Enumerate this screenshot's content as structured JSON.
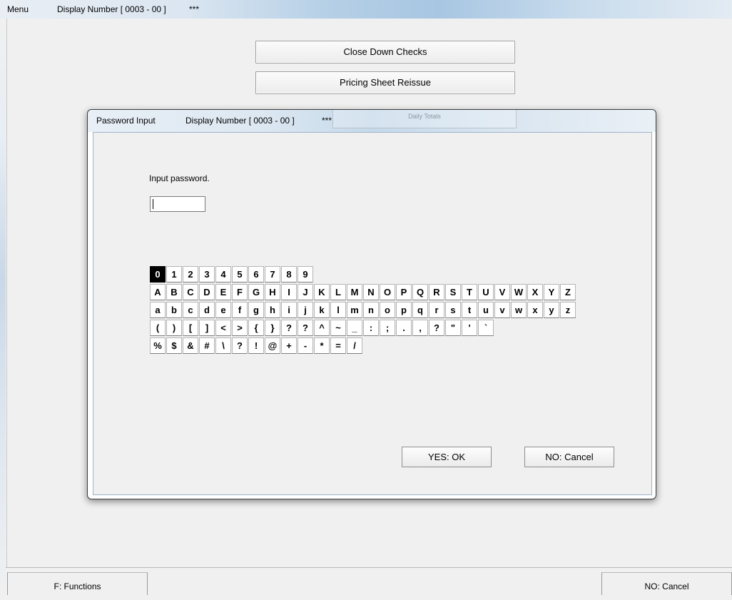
{
  "window": {
    "menu_label": "Menu",
    "display_number": "Display Number [ 0003 - 00 ]",
    "stars": "***"
  },
  "menu_buttons": [
    {
      "label": "Close Down Checks"
    },
    {
      "label": "Pricing Sheet Reissue"
    },
    {
      "label": "Daily Totals"
    }
  ],
  "dialog": {
    "title": "Password Input",
    "display_number": "Display Number [ 0003 - 00 ]",
    "stars": "***",
    "prompt": "Input password.",
    "password_value": "",
    "ok_label": "YES: OK",
    "cancel_label": "NO: Cancel"
  },
  "keyboard": {
    "selected": "0",
    "rows": [
      [
        "0",
        "1",
        "2",
        "3",
        "4",
        "5",
        "6",
        "7",
        "8",
        "9"
      ],
      [
        "A",
        "B",
        "C",
        "D",
        "E",
        "F",
        "G",
        "H",
        "I",
        "J",
        "K",
        "L",
        "M",
        "N",
        "O",
        "P",
        "Q",
        "R",
        "S",
        "T",
        "U",
        "V",
        "W",
        "X",
        "Y",
        "Z"
      ],
      [
        "a",
        "b",
        "c",
        "d",
        "e",
        "f",
        "g",
        "h",
        "i",
        "j",
        "k",
        "l",
        "m",
        "n",
        "o",
        "p",
        "q",
        "r",
        "s",
        "t",
        "u",
        "v",
        "w",
        "x",
        "y",
        "z"
      ],
      [
        "(",
        ")",
        "[",
        "]",
        "<",
        ">",
        "{",
        "}",
        "?",
        "?",
        "^",
        "~",
        "_",
        ":",
        ";",
        ".",
        ",",
        "?",
        "\"",
        "'",
        "`"
      ],
      [
        "%",
        "$",
        "&",
        "#",
        "\\",
        "?",
        "!",
        "@",
        "+",
        "-",
        "*",
        "=",
        "/"
      ]
    ]
  },
  "footer": {
    "functions_label": "F: Functions",
    "cancel_label": "NO: Cancel"
  }
}
